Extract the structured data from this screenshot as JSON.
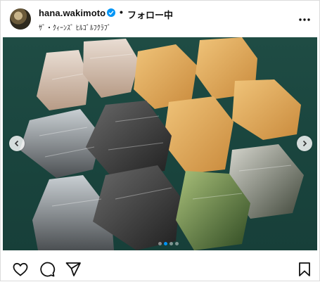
{
  "post": {
    "username": "hana.wakimoto",
    "separator": "•",
    "follow_label": "フォロー中",
    "subtitle": "ｻﾞ・ｸｨｰﾝｽﾞ ﾋﾙｺﾞﾙﾌｸﾗﾌﾞ",
    "more_label": "•••"
  },
  "carousel": {
    "image_description": "rice balls wrapped in plastic on a green table",
    "total_slides": 4,
    "active_slide": 2
  },
  "colors": {
    "accent": "#0095f6",
    "background": "#1f4c44"
  },
  "icons": [
    "verified-badge-icon",
    "more-icon",
    "chevron-left-icon",
    "chevron-right-icon",
    "heart-icon",
    "comment-icon",
    "share-icon",
    "bookmark-icon"
  ]
}
